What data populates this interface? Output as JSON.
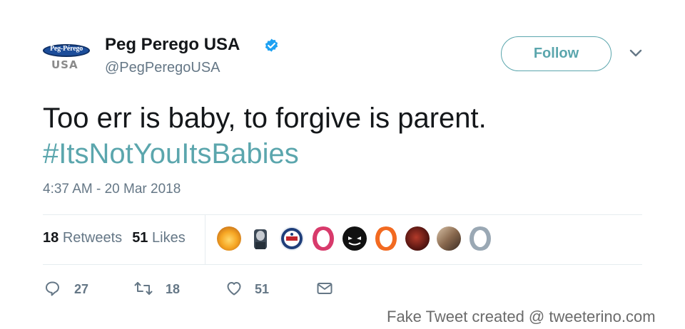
{
  "account": {
    "avatar_logo_text": "Peg-Pérego",
    "avatar_country_text": "USA",
    "display_name": "Peg Perego USA",
    "handle": "@PegPeregoUSA",
    "verified": true
  },
  "follow_button": {
    "label": "Follow"
  },
  "tweet": {
    "text": "Too err is baby, to forgive is parent.",
    "hashtag": "#ItsNotYouItsBabies",
    "timestamp": "4:37 AM - 20 Mar 2018"
  },
  "stats": {
    "retweets_count": "18",
    "retweets_label": "Retweets",
    "likes_count": "51",
    "likes_label": "Likes"
  },
  "likers": [
    {
      "name": "liker-avatar-1"
    },
    {
      "name": "liker-avatar-2"
    },
    {
      "name": "liker-avatar-3"
    },
    {
      "name": "liker-avatar-4"
    },
    {
      "name": "liker-avatar-5"
    },
    {
      "name": "liker-avatar-6"
    },
    {
      "name": "liker-avatar-7"
    },
    {
      "name": "liker-avatar-8"
    },
    {
      "name": "liker-avatar-9"
    }
  ],
  "actions": {
    "reply_count": "27",
    "retweet_count": "18",
    "like_count": "51"
  },
  "icons": {
    "verified": "verified-badge-icon",
    "chevron": "chevron-down-icon",
    "reply": "reply-icon",
    "retweet": "retweet-icon",
    "like": "heart-icon",
    "message": "envelope-icon"
  },
  "colors": {
    "accent": "#5ba6ad",
    "verified_blue": "#1da1f2",
    "muted_text": "#657786",
    "primary_text": "#14171a",
    "divider": "#e6ecf0"
  },
  "watermark": "Fake Tweet created @ tweeterino.com"
}
